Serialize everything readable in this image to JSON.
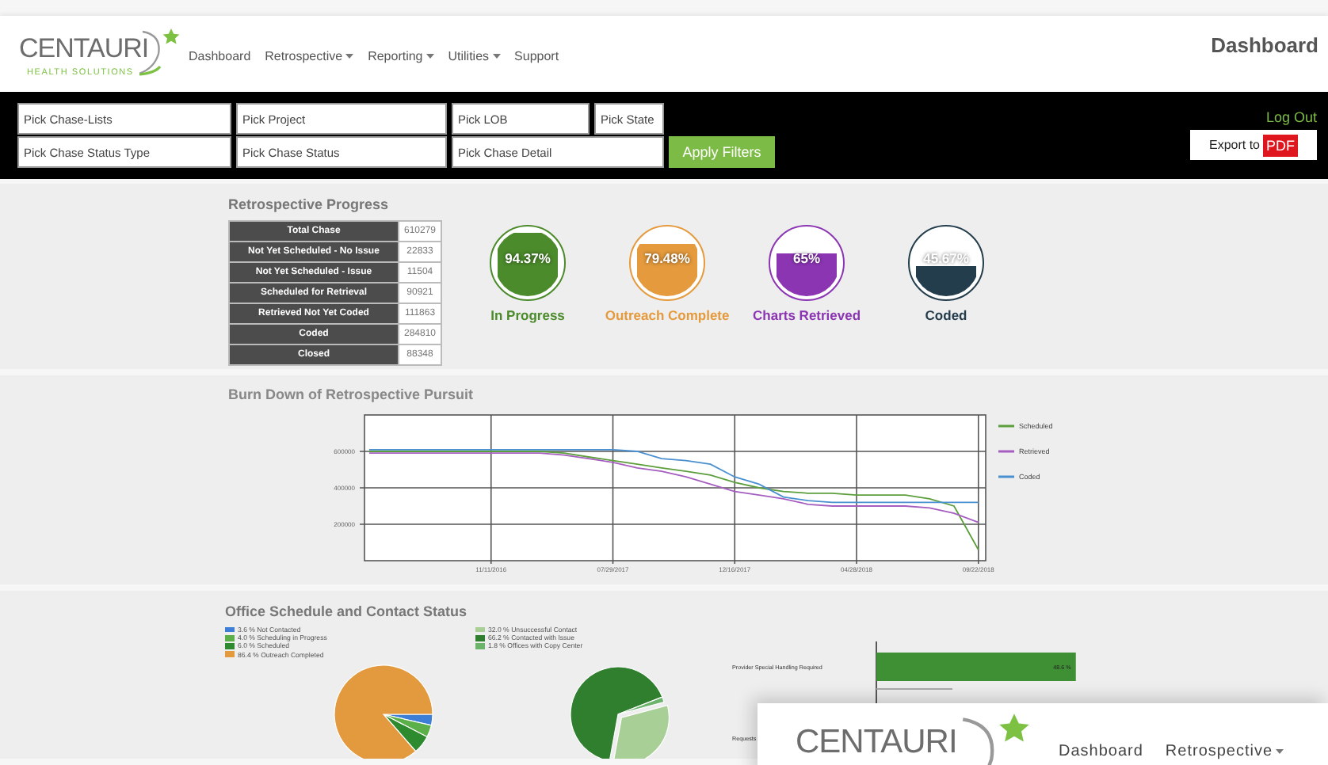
{
  "header": {
    "logo": {
      "name": "CENTAURI",
      "tagline": "HEALTH SOLUTIONS"
    },
    "nav": [
      {
        "label": "Dashboard",
        "dropdown": false
      },
      {
        "label": "Retrospective",
        "dropdown": true
      },
      {
        "label": "Reporting",
        "dropdown": true
      },
      {
        "label": "Utilities",
        "dropdown": true
      },
      {
        "label": "Support",
        "dropdown": false
      }
    ],
    "page_title": "Dashboard"
  },
  "filters": {
    "rows": [
      [
        {
          "placeholder": "Pick Chase-Lists"
        },
        {
          "placeholder": "Pick Project"
        },
        {
          "placeholder": "Pick LOB"
        },
        {
          "placeholder": "Pick State"
        }
      ],
      [
        {
          "placeholder": "Pick Chase Status Type"
        },
        {
          "placeholder": "Pick Chase Status"
        },
        {
          "placeholder": "Pick Chase Detail"
        }
      ]
    ],
    "apply_button": "Apply Filters",
    "logout": "Log Out",
    "export_button": {
      "label": "Export to",
      "badge": "PDF"
    }
  },
  "progress": {
    "title": "Retrospective Progress",
    "rows": [
      {
        "label": "Total Chase",
        "value": "610279"
      },
      {
        "label": "Not Yet Scheduled - No Issue",
        "value": "22833"
      },
      {
        "label": "Not Yet Scheduled - Issue",
        "value": "11504"
      },
      {
        "label": "Scheduled for Retrieval",
        "value": "90921"
      },
      {
        "label": "Retrieved Not Yet Coded",
        "value": "111863"
      },
      {
        "label": "Coded",
        "value": "284810"
      },
      {
        "label": "Closed",
        "value": "88348"
      }
    ],
    "gauges": [
      {
        "reading": "94.37%",
        "level": 0.9437,
        "label": "In Progress",
        "color": "#4b8b2b"
      },
      {
        "reading": "79.48%",
        "level": 0.7948,
        "label": "Outreach Complete",
        "color": "#e49a3d"
      },
      {
        "reading": "65%",
        "level": 0.65,
        "label": "Charts Retrieved",
        "color": "#8b35b3"
      },
      {
        "reading": "45.67%",
        "level": 0.4567,
        "label": "Coded",
        "color": "#233d4c"
      }
    ]
  },
  "burn_down": {
    "title": "Burn Down of Retrospective Pursuit",
    "chart_data": {
      "type": "line",
      "categories": [
        null,
        null,
        null,
        null,
        null,
        "11/11/2016",
        null,
        null,
        null,
        null,
        "07/29/2017",
        null,
        null,
        null,
        null,
        "12/16/2017",
        null,
        null,
        null,
        null,
        "04/28/2018",
        null,
        null,
        null,
        null,
        "09/22/2018"
      ],
      "series": [
        {
          "name": "Scheduled",
          "color": "#5c9e3c",
          "values": [
            600000,
            600000,
            600000,
            600000,
            600000,
            600000,
            600000,
            600000,
            590000,
            570000,
            550000,
            530000,
            510000,
            490000,
            470000,
            430000,
            400000,
            380000,
            370000,
            370000,
            360000,
            360000,
            360000,
            340000,
            300000,
            60000
          ]
        },
        {
          "name": "Retrieved",
          "color": "#a55ec0",
          "values": [
            590000,
            590000,
            590000,
            590000,
            590000,
            590000,
            590000,
            590000,
            580000,
            560000,
            540000,
            510000,
            490000,
            460000,
            420000,
            380000,
            360000,
            340000,
            310000,
            300000,
            300000,
            300000,
            300000,
            290000,
            260000,
            210000
          ]
        },
        {
          "name": "Coded",
          "color": "#4a90d0",
          "values": [
            610000,
            610000,
            610000,
            610000,
            610000,
            610000,
            610000,
            610000,
            610000,
            610000,
            610000,
            600000,
            560000,
            550000,
            530000,
            460000,
            420000,
            350000,
            330000,
            320000,
            320000,
            320000,
            320000,
            320000,
            320000,
            320000
          ]
        }
      ],
      "ylim": [
        0,
        800000
      ],
      "yticks": [
        200000,
        400000,
        600000
      ],
      "grid": true,
      "legend": "right"
    }
  },
  "office": {
    "title": "Office Schedule and Contact Status",
    "pies": [
      {
        "legend": [
          {
            "label": "3.6 % Not Contacted",
            "color": "#3d7fd6"
          },
          {
            "label": "4.0 % Scheduling in Progress",
            "color": "#5cb04a"
          },
          {
            "label": "6.0 % Scheduled",
            "color": "#2e8a2e"
          },
          {
            "label": "86.4 % Outreach Completed",
            "color": "#e39a3f"
          }
        ],
        "chart_data": {
          "type": "pie",
          "values": [
            3.6,
            4.0,
            6.0,
            86.4
          ]
        }
      },
      {
        "legend": [
          {
            "label": "32.0 % Unsuccessful Contact",
            "color": "#a8cf96"
          },
          {
            "label": "66.2 % Contacted with Issue",
            "color": "#2f7f2f"
          },
          {
            "label": "1.8 % Offices with Copy Center",
            "color": "#6cb36c"
          }
        ],
        "chart_data": {
          "type": "pie",
          "values": [
            32.0,
            66.2,
            1.8
          ]
        }
      }
    ],
    "bar_chart": {
      "chart_data": {
        "type": "bar",
        "orientation": "horizontal",
        "categories": [
          "Provider Special Handling Required",
          "Requests"
        ],
        "values": [
          48.6,
          null
        ],
        "value_labels": [
          "48.6 %",
          null
        ]
      }
    }
  },
  "overlay_window": {
    "logo": {
      "name": "CENTAURI"
    },
    "nav": [
      {
        "label": "Dashboard",
        "dropdown": false
      },
      {
        "label": "Retrospective",
        "dropdown": true
      }
    ]
  }
}
